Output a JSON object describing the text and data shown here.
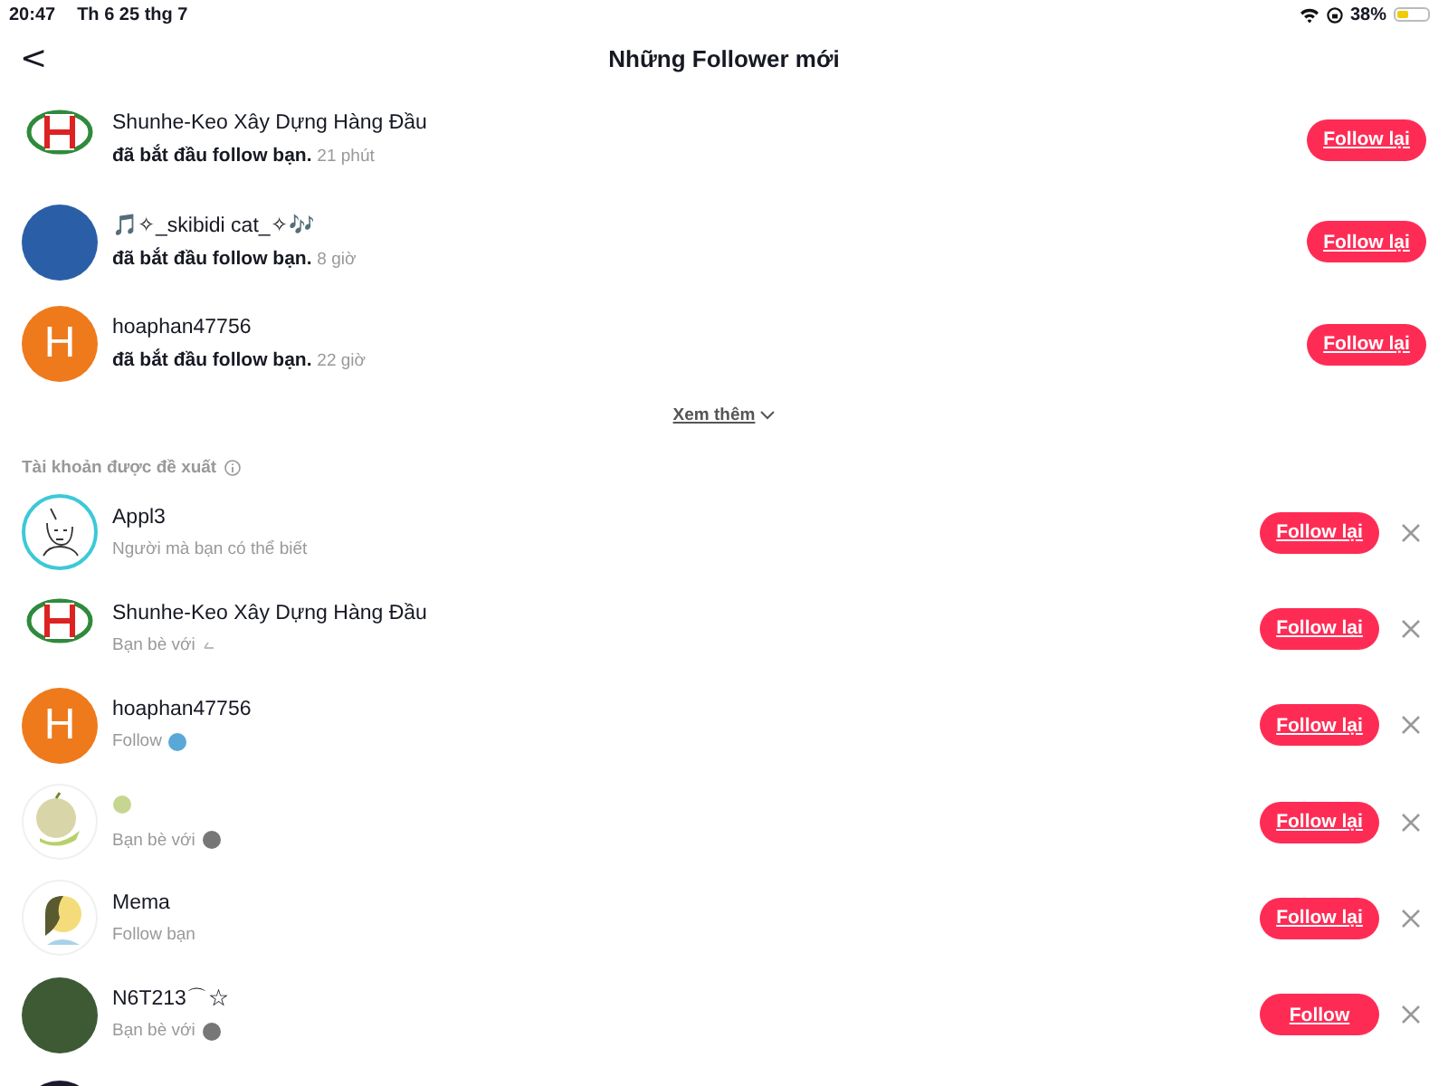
{
  "status_bar": {
    "time": "20:47",
    "date": "Th 6 25 thg 7",
    "battery_text": "38%",
    "battery": {
      "level": 0.38
    }
  },
  "header": {
    "back": "<",
    "title": "Những Follower mới"
  },
  "followers": [
    {
      "name": "Shunhe-Keo Xây Dựng Hàng Đầu",
      "action": "đã bắt đầu follow bạn.",
      "time": "21 phút",
      "avatar": {
        "kind": "logo"
      },
      "button": "Follow lại"
    },
    {
      "name": "🎵✧_skibidi cat_✧🎶",
      "action": "đã bắt đầu follow bạn.",
      "time": "8 giờ",
      "avatar": {
        "kind": "photo",
        "color": "#2a5fa8"
      },
      "button": "Follow lại"
    },
    {
      "name": "hoaphan47756",
      "action": "đã bắt đầu follow bạn.",
      "time": "22 giờ",
      "avatar": {
        "kind": "letter",
        "letter": "H",
        "color": "#ee7a1c"
      },
      "button": "Follow lại"
    }
  ],
  "see_more": "Xem thêm",
  "suggested_title": "Tài khoản được đề xuất",
  "suggested": [
    {
      "name": "Appl3",
      "subtitle": "Người mà bạn có thể biết",
      "avatar": {
        "kind": "sketch",
        "ring": true
      },
      "button": "Follow lại"
    },
    {
      "name": "Shunhe-Keo Xây Dựng Hàng Đầu",
      "subtitle": "Bạn bè với",
      "badge": {
        "kind": "tiny"
      },
      "avatar": {
        "kind": "logo"
      },
      "button": "Follow lại"
    },
    {
      "name": "hoaphan47756",
      "subtitle": "Follow",
      "badge": {
        "kind": "globe"
      },
      "avatar": {
        "kind": "letter",
        "letter": "H",
        "color": "#ee7a1c"
      },
      "button": "Follow lại"
    },
    {
      "name_icon": {
        "kind": "melon"
      },
      "subtitle": "Bạn bè với",
      "badge": {
        "kind": "photo"
      },
      "avatar": {
        "kind": "melon"
      },
      "button": "Follow lại"
    },
    {
      "name": "Mema",
      "subtitle": "Follow bạn",
      "avatar": {
        "kind": "cartoon"
      },
      "button": "Follow lại"
    },
    {
      "name": "N6T213⌒☆",
      "subtitle": "Bạn bè với",
      "badge": {
        "kind": "photo"
      },
      "avatar": {
        "kind": "photo",
        "color": "#3d5a34"
      },
      "button": "Follow"
    }
  ],
  "partial_row": {
    "avatar": {
      "kind": "photo",
      "color": "#1c1a30"
    }
  }
}
